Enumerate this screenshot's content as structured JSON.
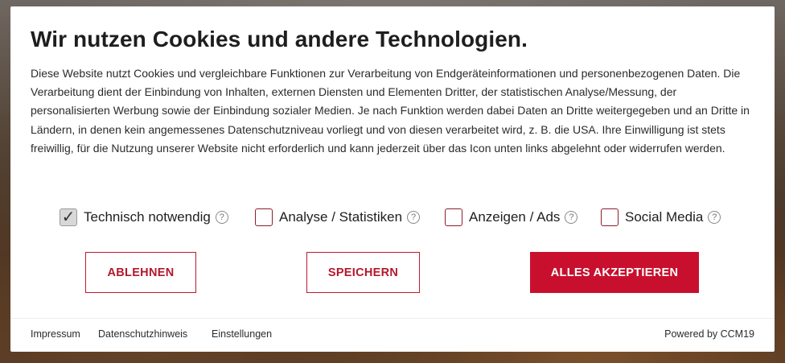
{
  "dialog": {
    "title": "Wir nutzen Cookies und andere Technologien.",
    "description": "Diese Website nutzt Cookies und vergleichbare Funktionen zur Verarbeitung von Endgeräteinformationen und personenbezogenen Daten. Die Verarbeitung dient der Einbindung von Inhalten, externen Diensten und Elementen Dritter, der statistischen Analyse/Messung, der personalisierten Werbung sowie der Einbindung sozialer Medien. Je nach Funktion werden dabei Daten an Dritte weitergegeben und an Dritte in Ländern, in denen kein angemessenes Datenschutzniveau vorliegt und von diesen verarbeitet wird, z. B. die USA. Ihre Einwilligung ist stets freiwillig, für die Nutzung unserer Website nicht erforderlich und kann jederzeit über das Icon unten links abgelehnt oder widerrufen werden."
  },
  "options": [
    {
      "label": "Technisch notwendig",
      "checked": true,
      "help": "?"
    },
    {
      "label": "Analyse / Statistiken",
      "checked": false,
      "help": "?"
    },
    {
      "label": "Anzeigen / Ads",
      "checked": false,
      "help": "?"
    },
    {
      "label": "Social Media",
      "checked": false,
      "help": "?"
    }
  ],
  "checkmark": "✓",
  "buttons": {
    "decline": "ABLEHNEN",
    "save": "SPEICHERN",
    "accept_all": "ALLES AKZEPTIEREN"
  },
  "footer": {
    "impressum": "Impressum",
    "privacy": "Datenschutzhinweis",
    "settings": "Einstellungen",
    "powered_by": "Powered by CCM19"
  },
  "colors": {
    "accent": "#c8102e",
    "checkbox_border": "#8a1e2e"
  }
}
